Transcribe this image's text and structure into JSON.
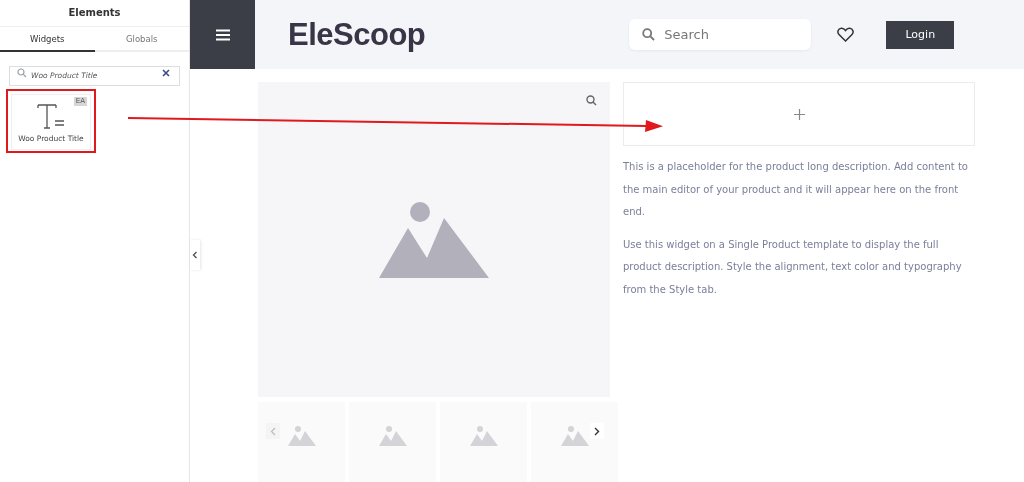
{
  "panel": {
    "title": "Elements",
    "tabs": [
      {
        "label": "Widgets",
        "selected": true
      },
      {
        "label": "Globals",
        "selected": false
      }
    ],
    "search": {
      "value": "Woo Product Title"
    },
    "widgets": [
      {
        "label": "Woo Product Title",
        "badge": "EA",
        "highlighted": true
      }
    ]
  },
  "header": {
    "logo": "EleScoop",
    "search": {
      "placeholder": "Search"
    },
    "login": "Login"
  },
  "description": [
    "This is a placeholder for the product long description. Add content to the main editor of your product and it will appear here on the front end.",
    "Use this widget on a Single Product template to display the full product description. Style the alignment, text color and typography from the Style tab."
  ]
}
